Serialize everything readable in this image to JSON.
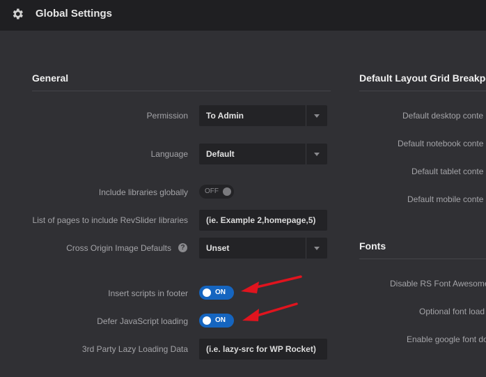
{
  "header": {
    "title": "Global Settings",
    "icon": "gear-icon"
  },
  "general": {
    "title": "General",
    "rows": {
      "permission": {
        "label": "Permission",
        "value": "To Admin"
      },
      "language": {
        "label": "Language",
        "value": "Default"
      },
      "include_libraries": {
        "label": "Include libraries globally",
        "toggle": "OFF"
      },
      "pages_list": {
        "label": "List of pages to include RevSlider libraries",
        "placeholder": "(ie. Example 2,homepage,5)"
      },
      "cross_origin": {
        "label": "Cross Origin Image Defaults",
        "value": "Unset",
        "help": "?"
      },
      "insert_scripts": {
        "label": "Insert scripts in footer",
        "toggle": "ON"
      },
      "defer_js": {
        "label": "Defer JavaScript loading",
        "toggle": "ON"
      },
      "lazy_loading": {
        "label": "3rd Party Lazy Loading Data",
        "placeholder": "(i.e. lazy-src for WP Rocket)"
      }
    }
  },
  "grid": {
    "title": "Default Layout Grid Breakpo",
    "rows": [
      "Default desktop conte",
      "Default notebook conte",
      "Default tablet conte",
      "Default mobile conte"
    ]
  },
  "fonts": {
    "title": "Fonts",
    "rows": [
      "Disable RS Font Awesome",
      "Optional font load",
      "Enable google font do"
    ]
  },
  "colors": {
    "background": "#303034",
    "header": "#1f1f22",
    "toggle_on": "#1565c0",
    "arrow": "#e0141e"
  }
}
